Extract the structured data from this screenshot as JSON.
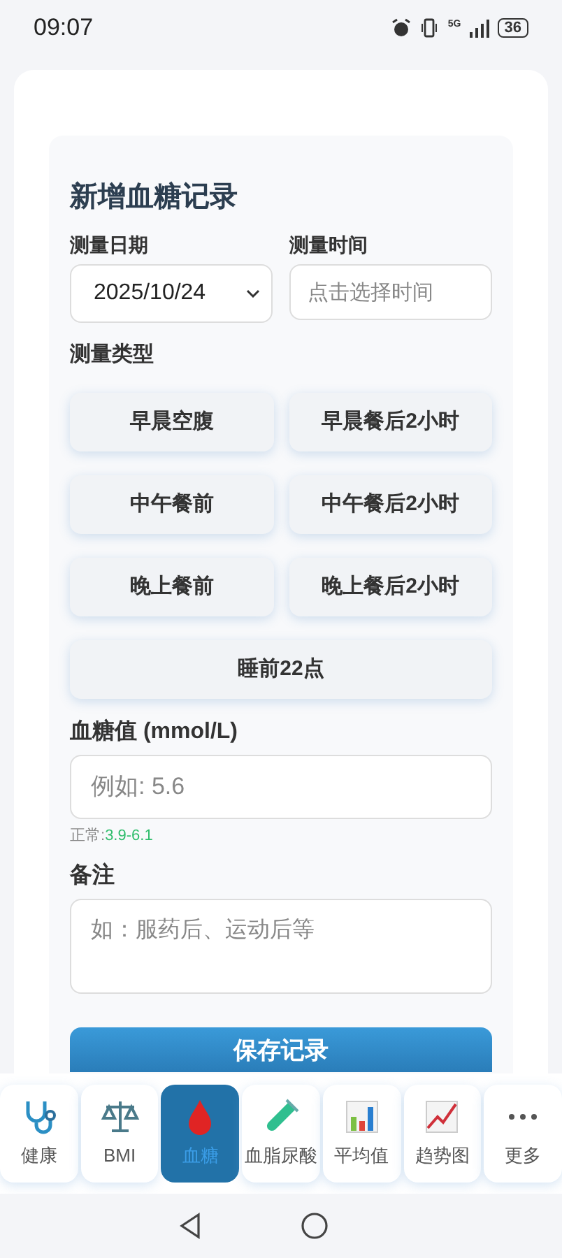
{
  "status_bar": {
    "time": "09:07",
    "network": "5G",
    "battery": "36"
  },
  "form": {
    "title": "新增血糖记录",
    "date": {
      "label": "测量日期",
      "value": "2025/10/24"
    },
    "time": {
      "label": "测量时间",
      "placeholder": "点击选择时间"
    },
    "type_label": "测量类型",
    "types": [
      {
        "label": "早晨空腹",
        "selected": false
      },
      {
        "label": "早晨餐后2小时",
        "selected": false
      },
      {
        "label": "中午餐前",
        "selected": false
      },
      {
        "label": "中午餐后2小时",
        "selected": false
      },
      {
        "label": "晚上餐前",
        "selected": false
      },
      {
        "label": "晚上餐后2小时",
        "selected": false
      },
      {
        "label": "睡前22点",
        "selected": false
      }
    ],
    "glucose": {
      "label": "血糖值 (mmol/L)",
      "placeholder": "例如: 5.6",
      "normal_label": "正常:",
      "normal_range": "3.9-6.1"
    },
    "note": {
      "label": "备注",
      "placeholder": "如：服药后、运动后等"
    },
    "save_button": "保存记录"
  },
  "bottom_nav": [
    {
      "label": "健康",
      "kind": "stethoscope",
      "selected": false
    },
    {
      "label": "BMI",
      "kind": "scale",
      "selected": false
    },
    {
      "label": "血糖",
      "kind": "drop",
      "selected": true
    },
    {
      "label": "血脂尿酸",
      "kind": "tube",
      "selected": false
    },
    {
      "label": "平均值",
      "kind": "bars",
      "selected": false
    },
    {
      "label": "趋势图",
      "kind": "trend",
      "selected": false
    },
    {
      "label": "更多",
      "kind": "dots",
      "selected": false
    }
  ]
}
